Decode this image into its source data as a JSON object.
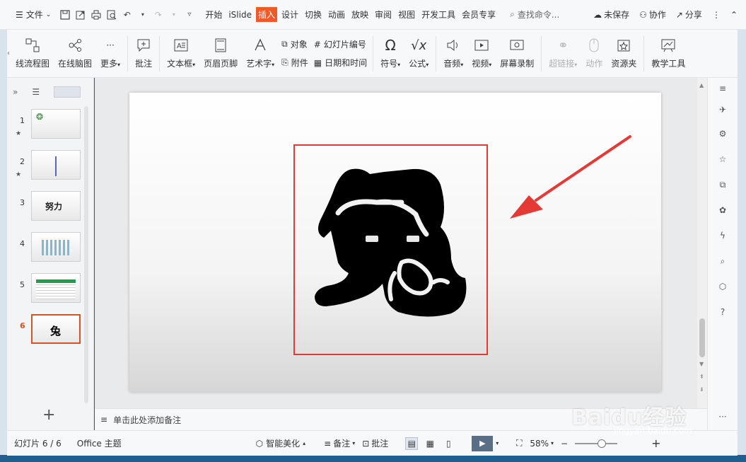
{
  "menubar": {
    "file_label": "文件",
    "tabs": [
      {
        "label": "开始",
        "active": false
      },
      {
        "label": "iSlide",
        "active": false
      },
      {
        "label": "插入",
        "active": true
      },
      {
        "label": "设计",
        "active": false
      },
      {
        "label": "切换",
        "active": false
      },
      {
        "label": "动画",
        "active": false
      },
      {
        "label": "放映",
        "active": false
      },
      {
        "label": "审阅",
        "active": false
      },
      {
        "label": "视图",
        "active": false
      },
      {
        "label": "开发工具",
        "active": false
      },
      {
        "label": "会员专享",
        "active": false
      }
    ],
    "search_placeholder": "查找命令...",
    "unsaved": "未保存",
    "collab": "协作",
    "share": "分享"
  },
  "ribbon": {
    "flowchart": "线流程图",
    "mindmap": "在线脑图",
    "more": "更多",
    "comment": "批注",
    "textbox": "文本框",
    "header_footer": "页眉页脚",
    "wordart": "艺术字",
    "object": "对象",
    "slide_number": "幻灯片编号",
    "attachment": "附件",
    "datetime": "日期和时间",
    "symbol": "符号",
    "formula": "公式",
    "audio": "音频",
    "video": "视频",
    "screen_record": "屏幕录制",
    "hyperlink": "超链接",
    "action": "动作",
    "resources": "资源夹",
    "teaching_tools": "教学工具"
  },
  "thumbnails": [
    {
      "num": "1",
      "star": true,
      "text": ""
    },
    {
      "num": "2",
      "star": true,
      "text": ""
    },
    {
      "num": "3",
      "star": false,
      "text": "努力"
    },
    {
      "num": "4",
      "star": false,
      "text": ""
    },
    {
      "num": "5",
      "star": false,
      "text": ""
    },
    {
      "num": "6",
      "star": false,
      "text": "兔",
      "active": true
    }
  ],
  "slide": {
    "character": "兔"
  },
  "notes_placeholder": "单击此处添加备注",
  "status": {
    "slide_info": "幻灯片 6 / 6",
    "theme": "Office 主题",
    "beautify": "智能美化",
    "notes": "备注",
    "comments": "批注",
    "zoom": "58%"
  },
  "watermark": {
    "brand": "Baidu经验",
    "url": "jingyan.baidu.com"
  },
  "colors": {
    "active_tab": "#f05a28",
    "highlight_box": "#e53935",
    "arrow": "#e53935",
    "active_thumb": "#d9531e"
  }
}
